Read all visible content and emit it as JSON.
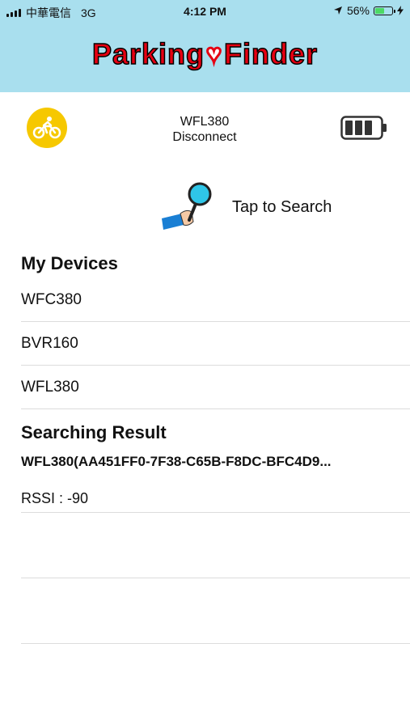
{
  "status_bar": {
    "carrier": "中華電信",
    "network": "3G",
    "time": "4:12 PM",
    "battery_percent": "56%",
    "battery_level": 0.56
  },
  "header": {
    "logo_part1": "Parking",
    "logo_part2": "Finder",
    "bg_color": "#a9dfee",
    "logo_color": "#e60012"
  },
  "device": {
    "name": "WFL380",
    "connection": "Disconnect",
    "icon": "bicycle-icon",
    "battery_bars": 3
  },
  "search": {
    "label": "Tap to Search",
    "icon": "magnifier-hand-icon"
  },
  "my_devices": {
    "title": "My Devices",
    "items": [
      "WFC380",
      "BVR160",
      "WFL380"
    ]
  },
  "results": {
    "title": "Searching Result",
    "items": [
      {
        "name": "WFL380(AA451FF0-7F38-C65B-F8DC-BFC4D9...",
        "rssi": "RSSI : -90"
      }
    ]
  }
}
